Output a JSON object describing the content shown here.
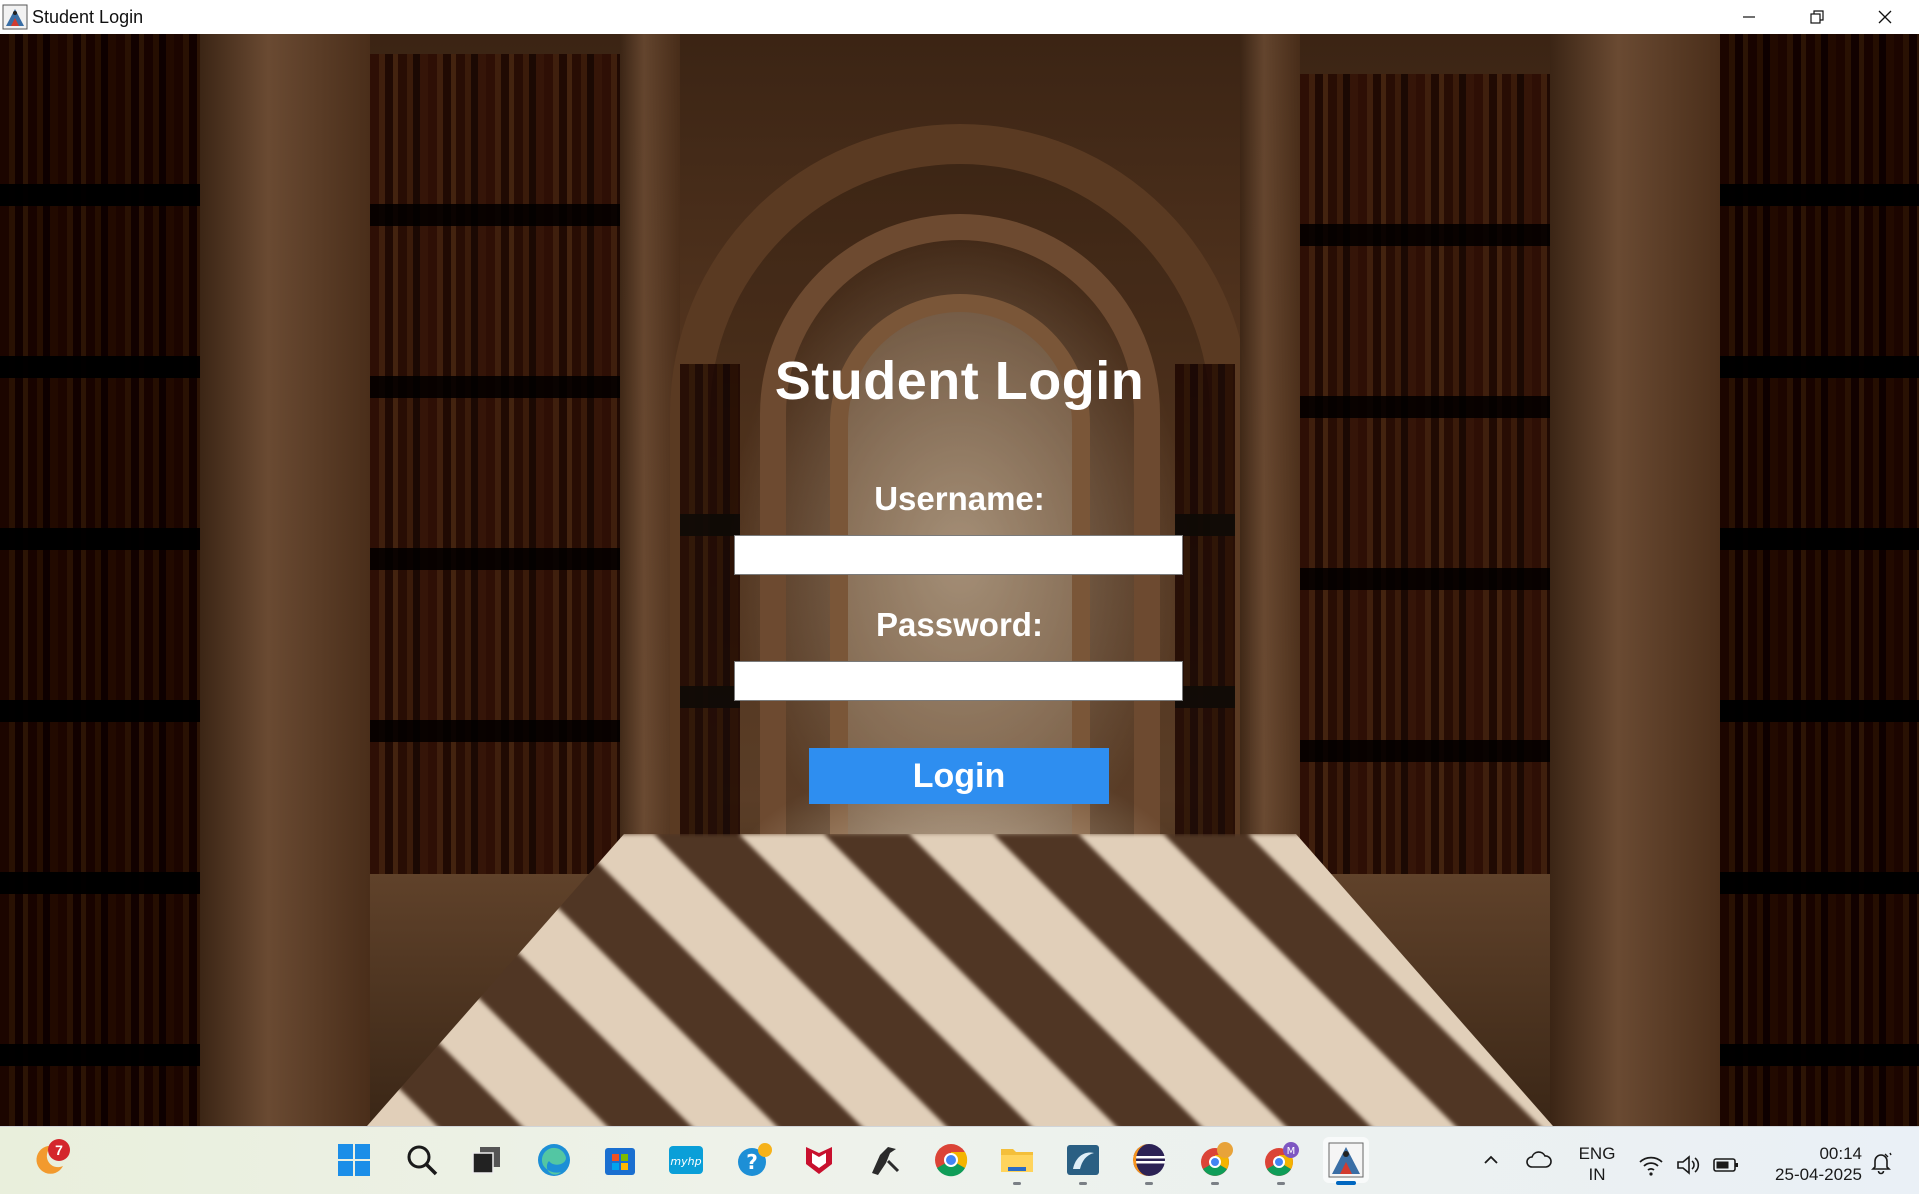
{
  "window": {
    "title": "Student Login"
  },
  "form": {
    "heading": "Student Login",
    "username_label": "Username:",
    "username_value": "",
    "password_label": "Password:",
    "password_value": "",
    "login_button": "Login",
    "button_color": "#2e8ef0"
  },
  "taskbar": {
    "widget_badge": "7",
    "pinned_apps": [
      "start-icon",
      "search-icon",
      "task-view-icon",
      "edge-icon",
      "store-icon",
      "myhp-icon",
      "help-icon",
      "mcafee-icon",
      "java-tool-icon",
      "chrome-icon",
      "file-explorer-icon",
      "mysql-workbench-icon",
      "eclipse-icon",
      "chrome-profile-icon",
      "chrome-profile-m-icon",
      "java-app-icon"
    ],
    "chrome_profile_letter": "M",
    "language_line1": "ENG",
    "language_line2": "IN",
    "time": "00:14",
    "date": "25-04-2025"
  }
}
